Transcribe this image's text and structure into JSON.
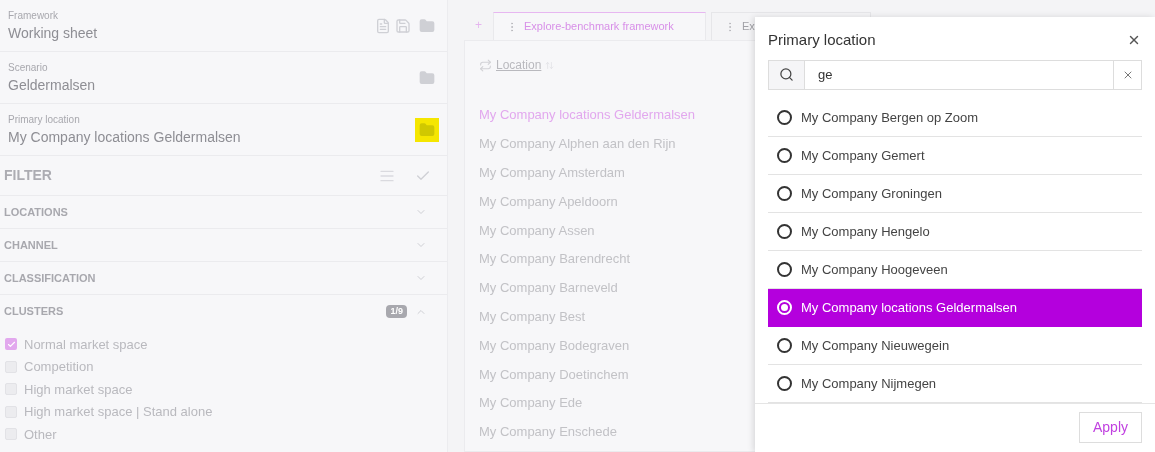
{
  "sidebar": {
    "fields": [
      {
        "label": "Framework",
        "value": "Working sheet",
        "highlighted": false
      },
      {
        "label": "Scenario",
        "value": "Geldermalsen",
        "highlighted": false
      },
      {
        "label": "Primary location",
        "value": "My Company locations Geldermalsen",
        "highlighted": true
      }
    ],
    "filter": {
      "title": "FILTER"
    },
    "sections": [
      {
        "title": "LOCATIONS",
        "expanded": false
      },
      {
        "title": "CHANNEL",
        "expanded": false
      },
      {
        "title": "CLASSIFICATION",
        "expanded": false
      },
      {
        "title": "CLUSTERS",
        "expanded": true,
        "badge": "1/9"
      }
    ],
    "clusters": [
      {
        "label": "Normal market space",
        "checked": true
      },
      {
        "label": "Competition",
        "checked": false
      },
      {
        "label": "High market space",
        "checked": false
      },
      {
        "label": "High market space | Stand alone",
        "checked": false
      },
      {
        "label": "Other",
        "checked": false
      }
    ]
  },
  "main": {
    "add_tab": "+",
    "tabs": [
      {
        "label": "Explore-benchmark framework",
        "selected": true
      },
      {
        "label": "Ex",
        "selected": false
      }
    ],
    "column": {
      "label": "Location"
    },
    "rows": [
      {
        "label": "My Company locations Geldermalsen",
        "selected": true
      },
      {
        "label": "My Company Alphen aan den Rijn",
        "selected": false
      },
      {
        "label": "My Company Amsterdam",
        "selected": false
      },
      {
        "label": "My Company Apeldoorn",
        "selected": false
      },
      {
        "label": "My Company Assen",
        "selected": false
      },
      {
        "label": "My Company Barendrecht",
        "selected": false
      },
      {
        "label": "My Company Barneveld",
        "selected": false
      },
      {
        "label": "My Company Best",
        "selected": false
      },
      {
        "label": "My Company Bodegraven",
        "selected": false
      },
      {
        "label": "My Company Doetinchem",
        "selected": false
      },
      {
        "label": "My Company Ede",
        "selected": false
      },
      {
        "label": "My Company Enschede",
        "selected": false
      }
    ]
  },
  "dialog": {
    "title": "Primary location",
    "search": {
      "value": "ge"
    },
    "options": [
      {
        "label": "My Company Bergen op Zoom",
        "selected": false
      },
      {
        "label": "My Company Gemert",
        "selected": false
      },
      {
        "label": "My Company Groningen",
        "selected": false
      },
      {
        "label": "My Company Hengelo",
        "selected": false
      },
      {
        "label": "My Company Hoogeveen",
        "selected": false
      },
      {
        "label": "My Company locations Geldermalsen",
        "selected": true
      },
      {
        "label": "My Company Nieuwegein",
        "selected": false
      },
      {
        "label": "My Company Nijmegen",
        "selected": false
      }
    ],
    "apply": "Apply"
  }
}
